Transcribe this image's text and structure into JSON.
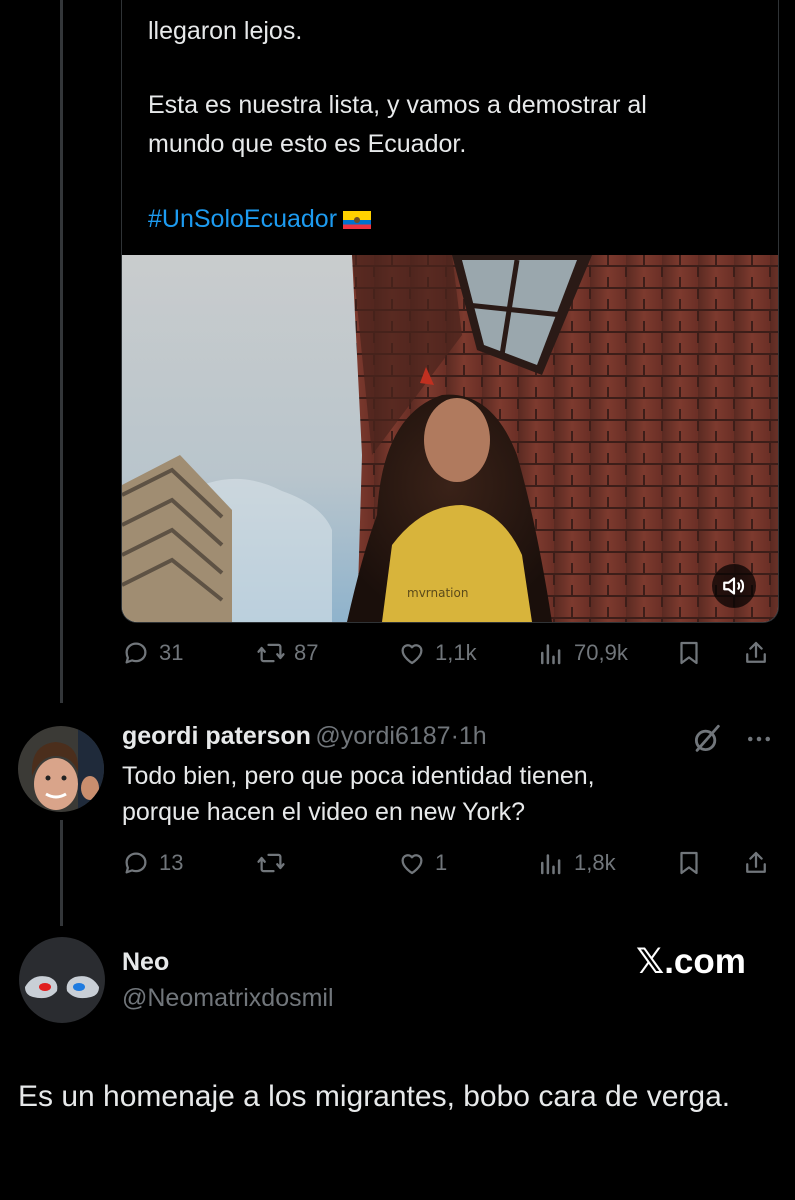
{
  "quoted_tweet": {
    "line1": "llegaron lejos.",
    "line2": "Esta es nuestra lista, y vamos a demostrar al",
    "line3": "mundo que esto es Ecuador.",
    "hashtag": "#UnSoloEcuador",
    "flag_icon": "ecuador-flag-icon",
    "media_overlay_icon": "speaker-icon"
  },
  "quoted_stats": {
    "replies": "31",
    "reposts": "87",
    "likes": "1,1k",
    "views": "70,9k"
  },
  "reply": {
    "display_name": "geordi paterson",
    "handle": "@yordi6187",
    "separator": "·",
    "time": "1h",
    "text_line1": "Todo bien, pero que poca identidad tienen,",
    "text_line2": "porque hacen el video en new York?",
    "stats": {
      "replies": "13",
      "reposts": "",
      "likes": "1",
      "views": "1,8k"
    }
  },
  "main_tweet": {
    "display_name": "Neo",
    "handle": "@Neomatrixdosmil",
    "brand": "𝕏.com",
    "text": "Es un homenaje a los migrantes,  bobo cara de verga."
  },
  "colors": {
    "background": "#000000",
    "text": "#e7e9ea",
    "muted": "#71767b",
    "link": "#1d9bf0",
    "border": "#2f3336"
  }
}
